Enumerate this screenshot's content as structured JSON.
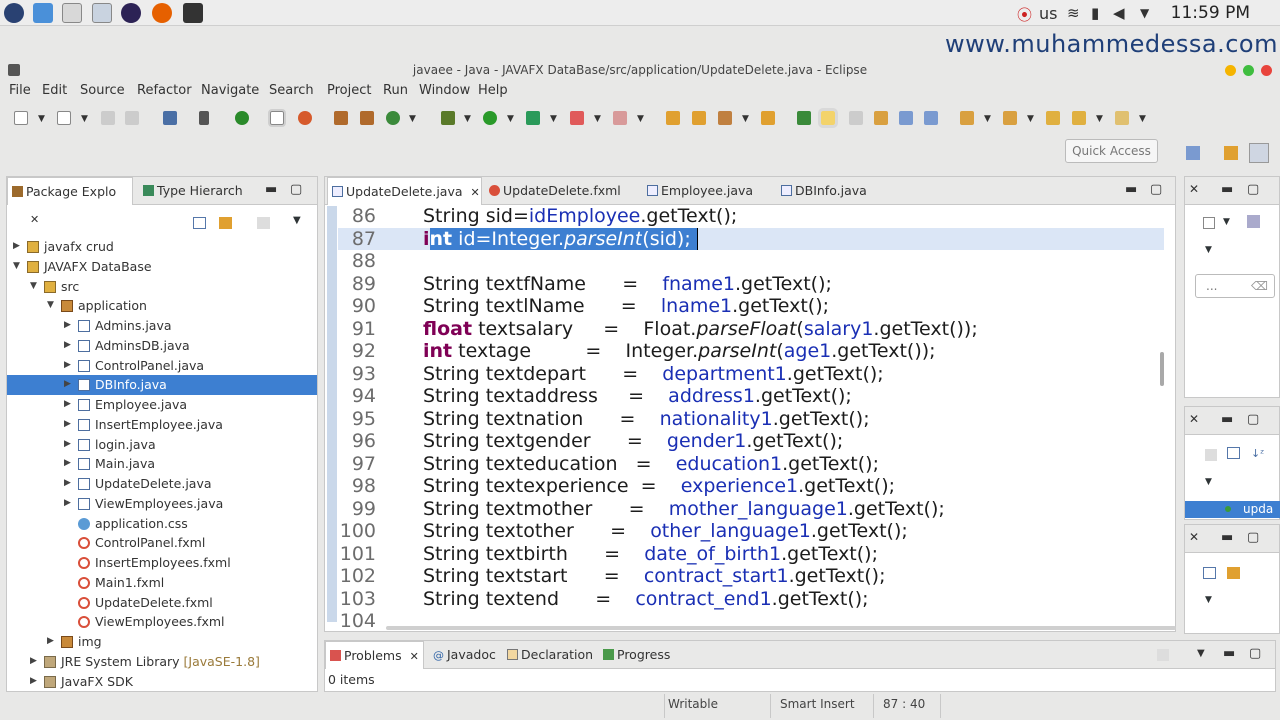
{
  "os": {
    "keyboard": "us",
    "clock": "11:59 PM"
  },
  "watermark": "www.muhammedessa.com",
  "window_title": "javaee - Java - JAVAFX DataBase/src/application/UpdateDelete.java - Eclipse",
  "menu": [
    "File",
    "Edit",
    "Source",
    "Refactor",
    "Navigate",
    "Search",
    "Project",
    "Run",
    "Window",
    "Help"
  ],
  "quick_access": "Quick Access",
  "package_explorer": {
    "tabs": [
      "Package Explo",
      "Type Hierarch"
    ],
    "rows": [
      {
        "label": "javafx crud",
        "indent": 0,
        "expanded": false,
        "icon": "project-icon"
      },
      {
        "label": "JAVAFX DataBase",
        "indent": 0,
        "expanded": true,
        "icon": "project-icon"
      },
      {
        "label": "src",
        "indent": 1,
        "expanded": true,
        "icon": "source-folder-icon"
      },
      {
        "label": "application",
        "indent": 2,
        "expanded": true,
        "icon": "package-icon"
      },
      {
        "label": "Admins.java",
        "indent": 3,
        "expanded": false,
        "icon": "java-file-icon"
      },
      {
        "label": "AdminsDB.java",
        "indent": 3,
        "expanded": false,
        "icon": "java-file-icon"
      },
      {
        "label": "ControlPanel.java",
        "indent": 3,
        "expanded": false,
        "icon": "java-file-icon"
      },
      {
        "label": "DBInfo.java",
        "indent": 3,
        "expanded": false,
        "icon": "java-file-icon",
        "selected": true
      },
      {
        "label": "Employee.java",
        "indent": 3,
        "expanded": false,
        "icon": "java-file-icon"
      },
      {
        "label": "InsertEmployee.java",
        "indent": 3,
        "expanded": false,
        "icon": "java-file-icon"
      },
      {
        "label": "login.java",
        "indent": 3,
        "expanded": false,
        "icon": "java-file-icon"
      },
      {
        "label": "Main.java",
        "indent": 3,
        "expanded": false,
        "icon": "java-file-icon"
      },
      {
        "label": "UpdateDelete.java",
        "indent": 3,
        "expanded": false,
        "icon": "java-file-icon"
      },
      {
        "label": "ViewEmployees.java",
        "indent": 3,
        "expanded": false,
        "icon": "java-file-icon"
      },
      {
        "label": "application.css",
        "indent": 3,
        "leaf": true,
        "icon": "css-file-icon"
      },
      {
        "label": "ControlPanel.fxml",
        "indent": 3,
        "leaf": true,
        "icon": "fxml-file-icon"
      },
      {
        "label": "InsertEmployees.fxml",
        "indent": 3,
        "leaf": true,
        "icon": "fxml-file-icon"
      },
      {
        "label": "Main1.fxml",
        "indent": 3,
        "leaf": true,
        "icon": "fxml-file-icon"
      },
      {
        "label": "UpdateDelete.fxml",
        "indent": 3,
        "leaf": true,
        "icon": "fxml-file-icon"
      },
      {
        "label": "ViewEmployees.fxml",
        "indent": 3,
        "leaf": true,
        "icon": "fxml-file-icon"
      },
      {
        "label": "img",
        "indent": 2,
        "expanded": false,
        "icon": "package-icon"
      },
      {
        "label": "JRE System Library",
        "suffix": "[JavaSE-1.8]",
        "indent": 1,
        "expanded": false,
        "icon": "library-icon"
      },
      {
        "label": "JavaFX SDK",
        "indent": 1,
        "expanded": false,
        "icon": "library-icon"
      }
    ]
  },
  "editor": {
    "tabs": [
      "UpdateDelete.java",
      "UpdateDelete.fxml",
      "Employee.java",
      "DBInfo.java"
    ],
    "lines": [
      {
        "n": "86",
        "parts": [
          [
            "t",
            "String sid="
          ],
          [
            "f",
            "idEmployee"
          ],
          [
            "t",
            ".getText();"
          ]
        ]
      },
      {
        "n": "87",
        "current": true,
        "parts": [
          [
            "k",
            "int"
          ],
          [
            "t",
            " id=Integer."
          ],
          [
            "i",
            "parseInt"
          ],
          [
            "t",
            "(sid);"
          ]
        ]
      },
      {
        "n": "88",
        "parts": []
      },
      {
        "n": "89",
        "parts": [
          [
            "t",
            "String textfName      =    "
          ],
          [
            "f",
            "fname1"
          ],
          [
            "t",
            ".getText();"
          ]
        ]
      },
      {
        "n": "90",
        "parts": [
          [
            "t",
            "String textlName      =    "
          ],
          [
            "f",
            "lname1"
          ],
          [
            "t",
            ".getText();"
          ]
        ]
      },
      {
        "n": "91",
        "parts": [
          [
            "k",
            "float"
          ],
          [
            "t",
            " textsalary     =    Float."
          ],
          [
            "i",
            "parseFloat"
          ],
          [
            "t",
            "("
          ],
          [
            "f",
            "salary1"
          ],
          [
            "t",
            ".getText());"
          ]
        ]
      },
      {
        "n": "92",
        "parts": [
          [
            "k",
            "int"
          ],
          [
            "t",
            " textage         =    Integer."
          ],
          [
            "i",
            "parseInt"
          ],
          [
            "t",
            "("
          ],
          [
            "f",
            "age1"
          ],
          [
            "t",
            ".getText());"
          ]
        ]
      },
      {
        "n": "93",
        "parts": [
          [
            "t",
            "String textdepart      =    "
          ],
          [
            "f",
            "department1"
          ],
          [
            "t",
            ".getText();"
          ]
        ]
      },
      {
        "n": "94",
        "parts": [
          [
            "t",
            "String textaddress     =    "
          ],
          [
            "f",
            "address1"
          ],
          [
            "t",
            ".getText();"
          ]
        ]
      },
      {
        "n": "95",
        "parts": [
          [
            "t",
            "String textnation      =    "
          ],
          [
            "f",
            "nationality1"
          ],
          [
            "t",
            ".getText();"
          ]
        ]
      },
      {
        "n": "96",
        "parts": [
          [
            "t",
            "String textgender      =    "
          ],
          [
            "f",
            "gender1"
          ],
          [
            "t",
            ".getText();"
          ]
        ]
      },
      {
        "n": "97",
        "parts": [
          [
            "t",
            "String texteducation   =    "
          ],
          [
            "f",
            "education1"
          ],
          [
            "t",
            ".getText();"
          ]
        ]
      },
      {
        "n": "98",
        "parts": [
          [
            "t",
            "String textexperience  =    "
          ],
          [
            "f",
            "experience1"
          ],
          [
            "t",
            ".getText();"
          ]
        ]
      },
      {
        "n": "99",
        "parts": [
          [
            "t",
            "String textmother      =    "
          ],
          [
            "f",
            "mother_language1"
          ],
          [
            "t",
            ".getText();"
          ]
        ]
      },
      {
        "n": "100",
        "parts": [
          [
            "t",
            "String textother      =    "
          ],
          [
            "f",
            "other_language1"
          ],
          [
            "t",
            ".getText();"
          ]
        ]
      },
      {
        "n": "101",
        "parts": [
          [
            "t",
            "String textbirth      =    "
          ],
          [
            "f",
            "date_of_birth1"
          ],
          [
            "t",
            ".getText();"
          ]
        ]
      },
      {
        "n": "102",
        "parts": [
          [
            "t",
            "String textstart      =    "
          ],
          [
            "f",
            "contract_start1"
          ],
          [
            "t",
            ".getText();"
          ]
        ]
      },
      {
        "n": "103",
        "parts": [
          [
            "t",
            "String textend      =    "
          ],
          [
            "f",
            "contract_end1"
          ],
          [
            "t",
            ".getText();"
          ]
        ]
      },
      {
        "n": "104",
        "parts": []
      }
    ]
  },
  "bottom_panel": {
    "tabs": [
      "Problems",
      "Javadoc",
      "Declaration",
      "Progress"
    ],
    "summary": "0 items"
  },
  "right_panel": {
    "search_placeholder": "...",
    "outline_item": "upda"
  },
  "status": {
    "mode": "Writable",
    "insert": "Smart Insert",
    "position": "87 : 40"
  }
}
